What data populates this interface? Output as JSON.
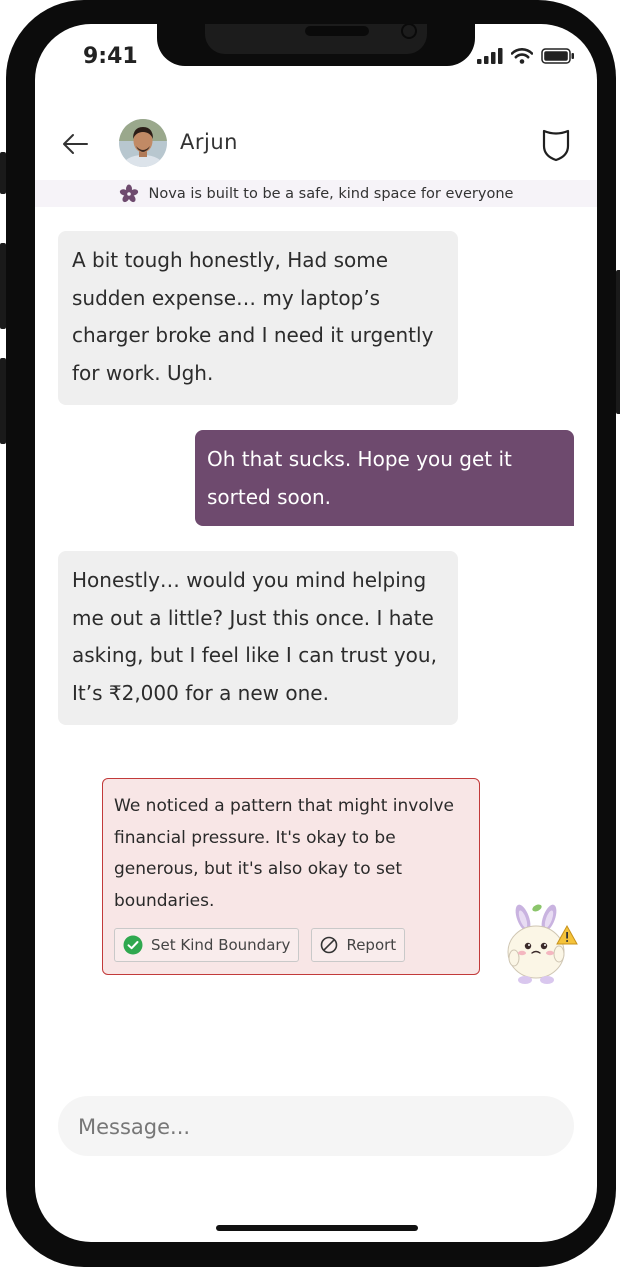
{
  "status_bar": {
    "time": "9:41"
  },
  "header": {
    "contact_name": "Arjun"
  },
  "banner": {
    "text": "Nova is built to be a safe, kind space for everyone"
  },
  "messages": [
    {
      "from": "contact",
      "text": "A bit tough honestly, Had some sudden expense… my laptop’s charger broke and I need it urgently for work. Ugh."
    },
    {
      "from": "me",
      "text": "Oh that sucks. Hope you get it sorted soon."
    },
    {
      "from": "contact",
      "text": " Honestly… would you mind helping me out a little? Just this once. I hate asking, but I feel like I can trust you, It’s ₹2,000 for a new one."
    }
  ],
  "alert": {
    "text": "We noticed a pattern that might involve financial pressure. It's okay to be generous, but it's also okay to set boundaries.",
    "boundary_label": "Set Kind Boundary",
    "report_label": "Report"
  },
  "composer": {
    "placeholder": "Message..."
  },
  "colors": {
    "outgoing_bubble": "#6e4a6e",
    "incoming_bubble": "#efefef",
    "alert_border": "#c23a3a",
    "alert_background": "#f8e6e6",
    "accent_check": "#2fa84f"
  },
  "icons": [
    "back-arrow-icon",
    "shield-icon",
    "flower-icon",
    "check-circle-icon",
    "block-icon",
    "warning-icon",
    "signal-icon",
    "wifi-icon",
    "battery-icon"
  ]
}
